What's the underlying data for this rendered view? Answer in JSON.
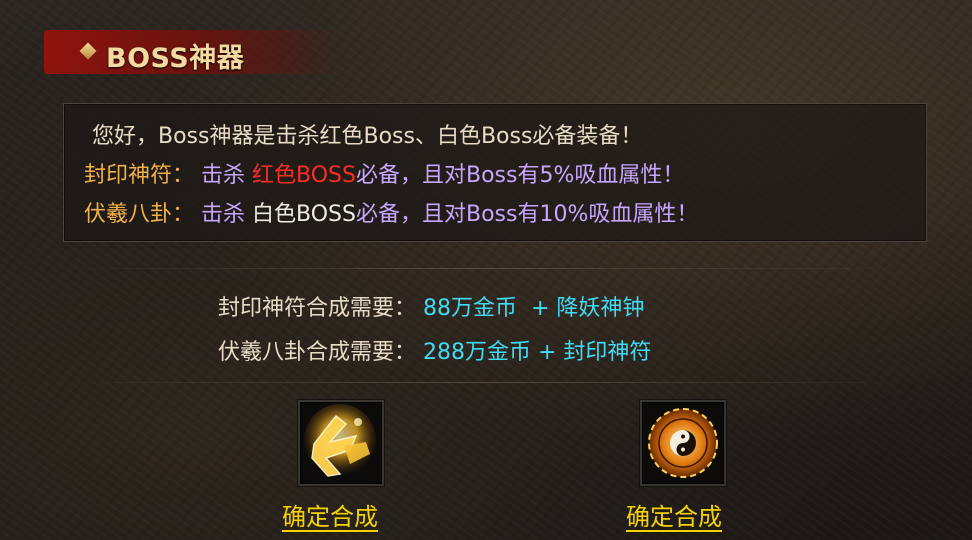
{
  "panel": {
    "title": "BOSS神器"
  },
  "info": {
    "line1": "您好，Boss神器是击杀红色Boss、白色Boss必备装备！",
    "item1_name": "封印神符：",
    "item1_prefix": "击杀",
    "item1_highlight": "红色BOSS",
    "item1_rest": "必备，且对Boss有5%吸血属性！",
    "item2_name": "伏羲八卦：",
    "item2_prefix": "击杀",
    "item2_highlight": "白色BOSS",
    "item2_rest": "必备，且对Boss有10%吸血属性！"
  },
  "requirements": [
    {
      "label": "封印神符合成需要：",
      "value": "88万金币  + 降妖神钟"
    },
    {
      "label": "伏羲八卦合成需要：",
      "value": "288万金币 + 封印神符"
    }
  ],
  "items": [
    {
      "icon": "seal-talisman-icon",
      "button_label": "确定合成"
    },
    {
      "icon": "bagua-compass-icon",
      "button_label": "确定合成"
    }
  ],
  "colors": {
    "title": "#f3d9a2",
    "item_name": "#f1b14a",
    "desc_purple": "#c7a6ff",
    "red_boss": "#ff2b25",
    "requirement_value": "#3fdcf4",
    "confirm_button": "#f5d300"
  }
}
